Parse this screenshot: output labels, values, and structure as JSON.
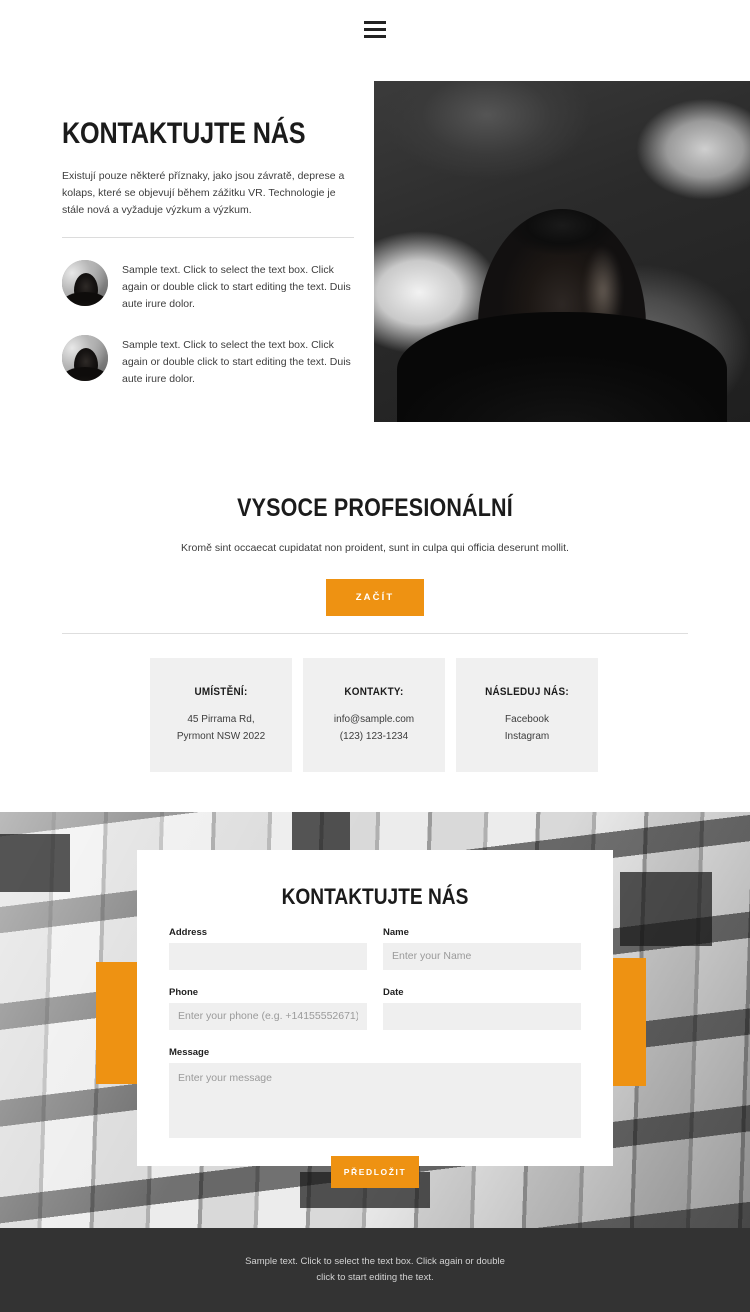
{
  "header": {
    "menu_icon": "hamburger-menu-icon"
  },
  "hero": {
    "title": "KONTAKTUJTE NÁS",
    "paragraph": "Existují pouze některé příznaky, jako jsou závratě, deprese a kolaps, které se objevují během zážitku VR. Technologie je stále nová a vyžaduje výzkum a výzkum.",
    "features": [
      {
        "text": "Sample text. Click to select the text box. Click again or double click to start editing the text. Duis aute irure dolor."
      },
      {
        "text": "Sample text. Click to select the text box. Click again or double click to start editing the text. Duis aute irure dolor."
      }
    ]
  },
  "mid": {
    "title": "VYSOCE PROFESIONÁLNÍ",
    "subtitle": "Kromě sint occaecat cupidatat non proident, sunt in culpa qui officia deserunt mollit.",
    "cta_label": "ZAČÍT"
  },
  "cards": [
    {
      "title": "UMÍSTĚNÍ:",
      "line1": "45 Pirrama Rd,",
      "line2": "Pyrmont NSW 2022"
    },
    {
      "title": "KONTAKTY:",
      "line1": "info@sample.com",
      "line2": "(123) 123-1234"
    },
    {
      "title": "NÁSLEDUJ NÁS:",
      "line1": "Facebook",
      "line2": "Instagram"
    }
  ],
  "form": {
    "title": "KONTAKTUJTE NÁS",
    "address_label": "Address",
    "address_placeholder": "",
    "address_value": "",
    "name_label": "Name",
    "name_placeholder": "Enter your Name",
    "name_value": "",
    "phone_label": "Phone",
    "phone_placeholder": "Enter your phone (e.g. +14155552671)",
    "phone_value": "",
    "date_label": "Date",
    "date_placeholder": "",
    "date_value": "",
    "message_label": "Message",
    "message_placeholder": "Enter your message",
    "message_value": "",
    "submit_label": "PŘEDLOŽIT"
  },
  "footer": {
    "text": "Sample text. Click to select the text box. Click again or double click to start editing the text."
  },
  "colors": {
    "accent": "#ee9212",
    "footer_bg": "#333333",
    "card_bg": "#f0f0f0",
    "input_bg": "#efefef",
    "text": "#1b1b1b"
  }
}
